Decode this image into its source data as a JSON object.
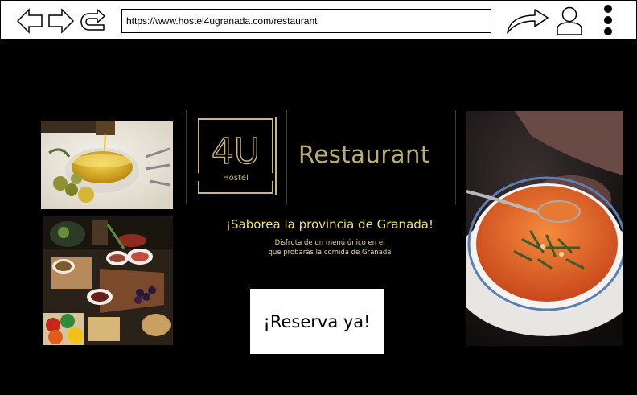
{
  "browser": {
    "url": "https://www.hostel4ugranada.com/restaurant"
  },
  "logo": {
    "mark": "4U",
    "sub": "Hostel",
    "title": "Restaurant",
    "accent_color": "#c8b784",
    "title_color": "#b9ad72"
  },
  "hero": {
    "tagline": "¡Saborea la provincia de Granada!",
    "subtitle_line1": "Disfruta de un menú único en el",
    "subtitle_line2": "que probarás la comida de Granada",
    "text_color": "#f2df6e"
  },
  "cta": {
    "label": "¡Reserva ya!"
  },
  "icons": {
    "back": "back-arrow-icon",
    "forward": "forward-arrow-icon",
    "reload": "reload-icon",
    "share": "share-arrow-icon",
    "user": "user-icon",
    "menu": "kebab-menu-icon"
  }
}
